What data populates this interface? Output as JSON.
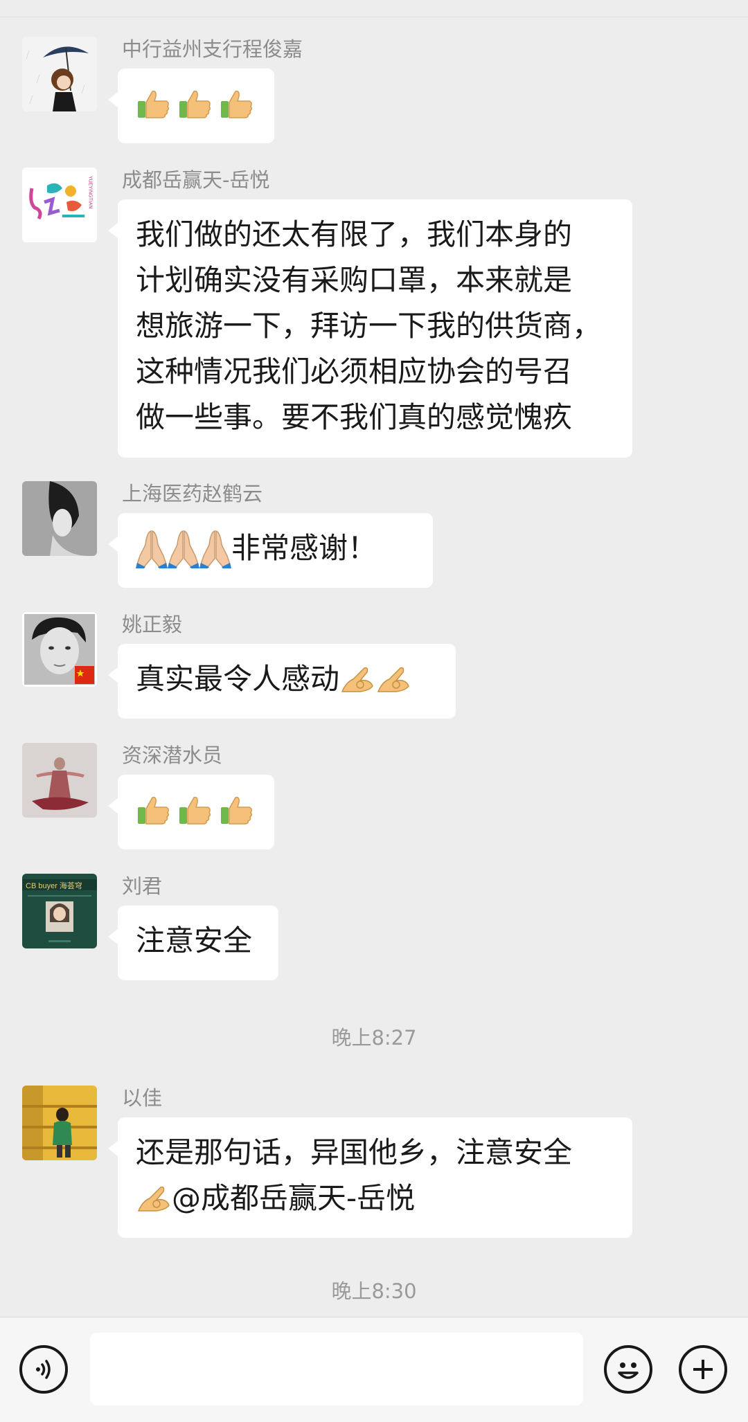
{
  "messages": [
    {
      "sender": "中行益州支行程俊嘉",
      "emojis": [
        "thumbs-up",
        "thumbs-up",
        "thumbs-up"
      ]
    },
    {
      "sender": "成都岳赢天-岳悦",
      "lines": [
        "我们做的还太有限了，我们本身的",
        "计划确实没有采购口罩，本来就是",
        "想旅游一下，拜访一下我的供货商，",
        "这种情况我们必须相应协会的号召",
        "做一些事。要不我们真的感觉愧疚"
      ]
    },
    {
      "sender": "上海医药赵鹤云",
      "emojis": [
        "folded-hands",
        "folded-hands",
        "folded-hands"
      ],
      "text": "非常感谢！"
    },
    {
      "sender": "姚正毅",
      "text": "真实最令人感动",
      "emojis": [
        "ok-hand",
        "ok-hand"
      ]
    },
    {
      "sender": "资深潜水员",
      "emojis": [
        "thumbs-up",
        "thumbs-up",
        "thumbs-up"
      ]
    },
    {
      "sender": "刘君",
      "text": "注意安全"
    },
    {
      "sender": "以佳",
      "line1": "还是那句话，异国他乡，注意安全",
      "line2": "@成都岳赢天-岳悦",
      "emojis": [
        "ok-hand"
      ]
    }
  ],
  "avatars": {
    "a2_logo_text": "YUEYINGTIAN",
    "a6_brand": "CB buyer 海荟穹"
  },
  "timestamps": {
    "t1": "晚上8:27",
    "t2": "晚上8:30"
  },
  "input_bar": {
    "voice_icon": "voice-icon",
    "emoji_icon": "emoji-icon",
    "plus_icon": "plus-icon",
    "text_value": ""
  }
}
